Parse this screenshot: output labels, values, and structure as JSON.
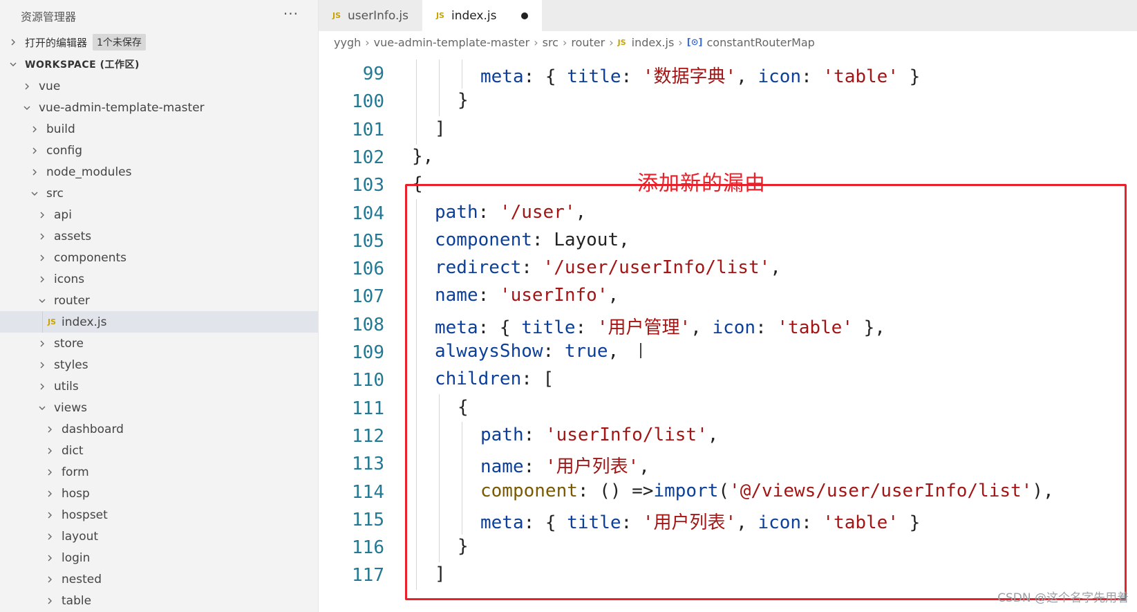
{
  "sidebar": {
    "title": "资源管理器",
    "more_label": "···",
    "open_editors": {
      "label": "打开的编辑器",
      "badge": "1个未保存"
    },
    "workspace": {
      "label": "WORKSPACE (工作区)"
    },
    "tree": [
      {
        "label": "vue",
        "expanded": false,
        "depth": 1
      },
      {
        "label": "vue-admin-template-master",
        "expanded": true,
        "depth": 1
      },
      {
        "label": "build",
        "expanded": false,
        "depth": 2
      },
      {
        "label": "config",
        "expanded": false,
        "depth": 2
      },
      {
        "label": "node_modules",
        "expanded": false,
        "depth": 2
      },
      {
        "label": "src",
        "expanded": true,
        "depth": 2
      },
      {
        "label": "api",
        "expanded": false,
        "depth": 3
      },
      {
        "label": "assets",
        "expanded": false,
        "depth": 3
      },
      {
        "label": "components",
        "expanded": false,
        "depth": 3
      },
      {
        "label": "icons",
        "expanded": false,
        "depth": 3
      },
      {
        "label": "router",
        "expanded": true,
        "depth": 3
      },
      {
        "label": "index.js",
        "file": true,
        "active": true,
        "depth": 4
      },
      {
        "label": "store",
        "expanded": false,
        "depth": 3
      },
      {
        "label": "styles",
        "expanded": false,
        "depth": 3
      },
      {
        "label": "utils",
        "expanded": false,
        "depth": 3
      },
      {
        "label": "views",
        "expanded": true,
        "depth": 3
      },
      {
        "label": "dashboard",
        "expanded": false,
        "depth": 4
      },
      {
        "label": "dict",
        "expanded": false,
        "depth": 4
      },
      {
        "label": "form",
        "expanded": false,
        "depth": 4
      },
      {
        "label": "hosp",
        "expanded": false,
        "depth": 4
      },
      {
        "label": "hospset",
        "expanded": false,
        "depth": 4
      },
      {
        "label": "layout",
        "expanded": false,
        "depth": 4
      },
      {
        "label": "login",
        "expanded": false,
        "depth": 4
      },
      {
        "label": "nested",
        "expanded": false,
        "depth": 4
      },
      {
        "label": "table",
        "expanded": false,
        "depth": 4
      }
    ]
  },
  "tabs": [
    {
      "label": "userInfo.js",
      "file_type": "JS",
      "active": false
    },
    {
      "label": "index.js",
      "file_type": "JS",
      "active": true,
      "dirty": true
    }
  ],
  "breadcrumb": [
    "yygh",
    "vue-admin-template-master",
    "src",
    "router",
    "index.js",
    "constantRouterMap"
  ],
  "editor": {
    "lines": [
      {
        "n": "99",
        "indent": 3,
        "tokens": [
          [
            "k",
            "meta"
          ],
          [
            "p",
            ": { "
          ],
          [
            "k",
            "title"
          ],
          [
            "p",
            ": "
          ],
          [
            "s",
            "'数据字典'"
          ],
          [
            "p",
            ", "
          ],
          [
            "k",
            "icon"
          ],
          [
            "p",
            ": "
          ],
          [
            "s",
            "'table'"
          ],
          [
            "p",
            " }"
          ]
        ]
      },
      {
        "n": "100",
        "indent": 2,
        "tokens": [
          [
            "p",
            "}"
          ]
        ]
      },
      {
        "n": "101",
        "indent": 1,
        "tokens": [
          [
            "p",
            "]"
          ]
        ]
      },
      {
        "n": "102",
        "indent": 0,
        "tokens": [
          [
            "p",
            "},"
          ]
        ]
      },
      {
        "n": "103",
        "indent": 0,
        "tokens": [
          [
            "p",
            "{"
          ]
        ]
      },
      {
        "n": "104",
        "indent": 1,
        "tokens": [
          [
            "k",
            "path"
          ],
          [
            "p",
            ": "
          ],
          [
            "s",
            "'/user'"
          ],
          [
            "p",
            ","
          ]
        ]
      },
      {
        "n": "105",
        "indent": 1,
        "tokens": [
          [
            "k",
            "component"
          ],
          [
            "p",
            ": Layout,"
          ]
        ]
      },
      {
        "n": "106",
        "indent": 1,
        "tokens": [
          [
            "k",
            "redirect"
          ],
          [
            "p",
            ": "
          ],
          [
            "s",
            "'/user/userInfo/list'"
          ],
          [
            "p",
            ","
          ]
        ]
      },
      {
        "n": "107",
        "indent": 1,
        "tokens": [
          [
            "k",
            "name"
          ],
          [
            "p",
            ": "
          ],
          [
            "s",
            "'userInfo'"
          ],
          [
            "p",
            ","
          ]
        ]
      },
      {
        "n": "108",
        "indent": 1,
        "tokens": [
          [
            "k",
            "meta"
          ],
          [
            "p",
            ": { "
          ],
          [
            "k",
            "title"
          ],
          [
            "p",
            ": "
          ],
          [
            "s",
            "'用户管理'"
          ],
          [
            "p",
            ", "
          ],
          [
            "k",
            "icon"
          ],
          [
            "p",
            ": "
          ],
          [
            "s",
            "'table'"
          ],
          [
            "p",
            " },"
          ]
        ]
      },
      {
        "n": "109",
        "indent": 1,
        "tokens": [
          [
            "k",
            "alwaysShow"
          ],
          [
            "p",
            ": "
          ],
          [
            "kw",
            "true"
          ],
          [
            "p",
            ","
          ]
        ]
      },
      {
        "n": "110",
        "indent": 1,
        "tokens": [
          [
            "k",
            "children"
          ],
          [
            "p",
            ": ["
          ]
        ]
      },
      {
        "n": "111",
        "indent": 2,
        "tokens": [
          [
            "p",
            "{"
          ]
        ]
      },
      {
        "n": "112",
        "indent": 3,
        "tokens": [
          [
            "k",
            "path"
          ],
          [
            "p",
            ": "
          ],
          [
            "s",
            "'userInfo/list'"
          ],
          [
            "p",
            ","
          ]
        ]
      },
      {
        "n": "113",
        "indent": 3,
        "tokens": [
          [
            "k",
            "name"
          ],
          [
            "p",
            ": "
          ],
          [
            "s",
            "'用户列表'"
          ],
          [
            "p",
            ","
          ]
        ]
      },
      {
        "n": "114",
        "indent": 3,
        "tokens": [
          [
            "fn",
            "component"
          ],
          [
            "p",
            ": () =>"
          ],
          [
            "kw",
            "import"
          ],
          [
            "p",
            "("
          ],
          [
            "s",
            "'@/views/user/userInfo/list'"
          ],
          [
            "p",
            "),"
          ]
        ]
      },
      {
        "n": "115",
        "indent": 3,
        "tokens": [
          [
            "k",
            "meta"
          ],
          [
            "p",
            ": { "
          ],
          [
            "k",
            "title"
          ],
          [
            "p",
            ": "
          ],
          [
            "s",
            "'用户列表'"
          ],
          [
            "p",
            ", "
          ],
          [
            "k",
            "icon"
          ],
          [
            "p",
            ": "
          ],
          [
            "s",
            "'table'"
          ],
          [
            "p",
            " }"
          ]
        ]
      },
      {
        "n": "116",
        "indent": 2,
        "tokens": [
          [
            "p",
            "}"
          ]
        ]
      },
      {
        "n": "117",
        "indent": 1,
        "tokens": [
          [
            "p",
            "]"
          ]
        ]
      }
    ]
  },
  "annotation": {
    "label": "添加新的漏由",
    "color": "#e8202a"
  },
  "watermark": "CSDN @这个名字先用着"
}
